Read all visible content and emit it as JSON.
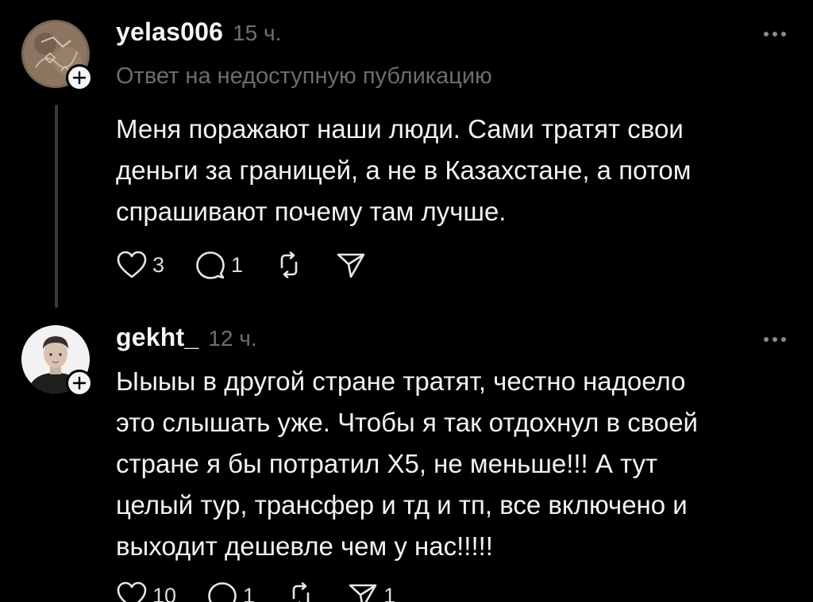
{
  "posts": [
    {
      "username": "yelas006",
      "time": "15 ч.",
      "reply_note": "Ответ на недоступную публикацию",
      "lines": [
        "Меня поражают наши люди. Сами тратят свои",
        "деньги за границей, а не в Казахстане, а потом",
        "спрашивают почему там лучше."
      ],
      "likes": "3",
      "comments": "1",
      "reposts": "",
      "shares": ""
    },
    {
      "username": "gekht_",
      "time": "12 ч.",
      "lines": [
        "Ыыыы в другой стране тратят, честно надоело",
        "это слышать уже. Чтобы я так отдохнул в своей",
        "стране я бы потратил Х5, не меньше!!! А тут",
        "целый тур, трансфер и тд и тп, все включено и",
        "выходит дешевле чем у нас!!!!!"
      ],
      "likes": "10",
      "comments": "1",
      "reposts": "",
      "shares": "1"
    }
  ],
  "icons": {
    "like": "heart-icon",
    "comment": "comment-bubble-icon",
    "repost": "repost-icon",
    "share": "send-icon",
    "more": "more-dots-icon",
    "follow": "plus-icon"
  },
  "colors": {
    "background": "#000000",
    "text": "#f2f2f2",
    "muted": "#6f6f6f",
    "thread_line": "#3a3a3a"
  }
}
